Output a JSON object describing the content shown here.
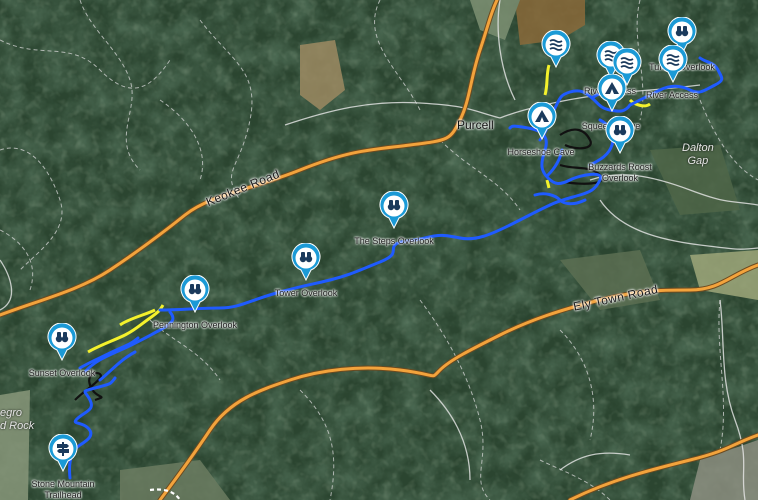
{
  "map": {
    "roads": {
      "keokee": "Keokee Road",
      "elytown": "Ely Town Road"
    },
    "places": {
      "purcell": "Purcell"
    },
    "areas": {
      "dalton_gap": [
        "Dalton",
        "Gap"
      ],
      "negro_rock": [
        "egro",
        "d Rock"
      ]
    },
    "pois": [
      {
        "label": "Tunnel Overlook",
        "icon": "binoculars-icon"
      },
      {
        "label": "River Access",
        "icon": "water-icon"
      },
      {
        "label": "River Access",
        "icon": "water-icon"
      },
      {
        "label": "Squeezy Cave",
        "icon": "cave-icon"
      },
      {
        "label": "Horseshoe Cave",
        "icon": "cave-icon"
      },
      {
        "label": "Buzzards Roost Overlook",
        "label_lines": [
          "Buzzards Roost",
          "Overlook"
        ],
        "icon": "binoculars-icon"
      },
      {
        "label": "The Steps Overlook",
        "icon": "binoculars-icon"
      },
      {
        "label": "Tower Overlook",
        "icon": "binoculars-icon"
      },
      {
        "label": "Pennington Overlook",
        "icon": "binoculars-icon"
      },
      {
        "label": "Sunset Overlook",
        "icon": "binoculars-icon"
      },
      {
        "label": "Stone Mountain Trailhead",
        "label_lines": [
          "Stone Mountain",
          "Trailhead"
        ],
        "icon": "signpost-icon"
      }
    ],
    "colors": {
      "main_road": "#f2a33c",
      "trail_blue": "#1f5bff",
      "trail_yellow": "#f4f12c",
      "pin_blue": "#1b9ad6",
      "forest": "#2a4430"
    }
  }
}
